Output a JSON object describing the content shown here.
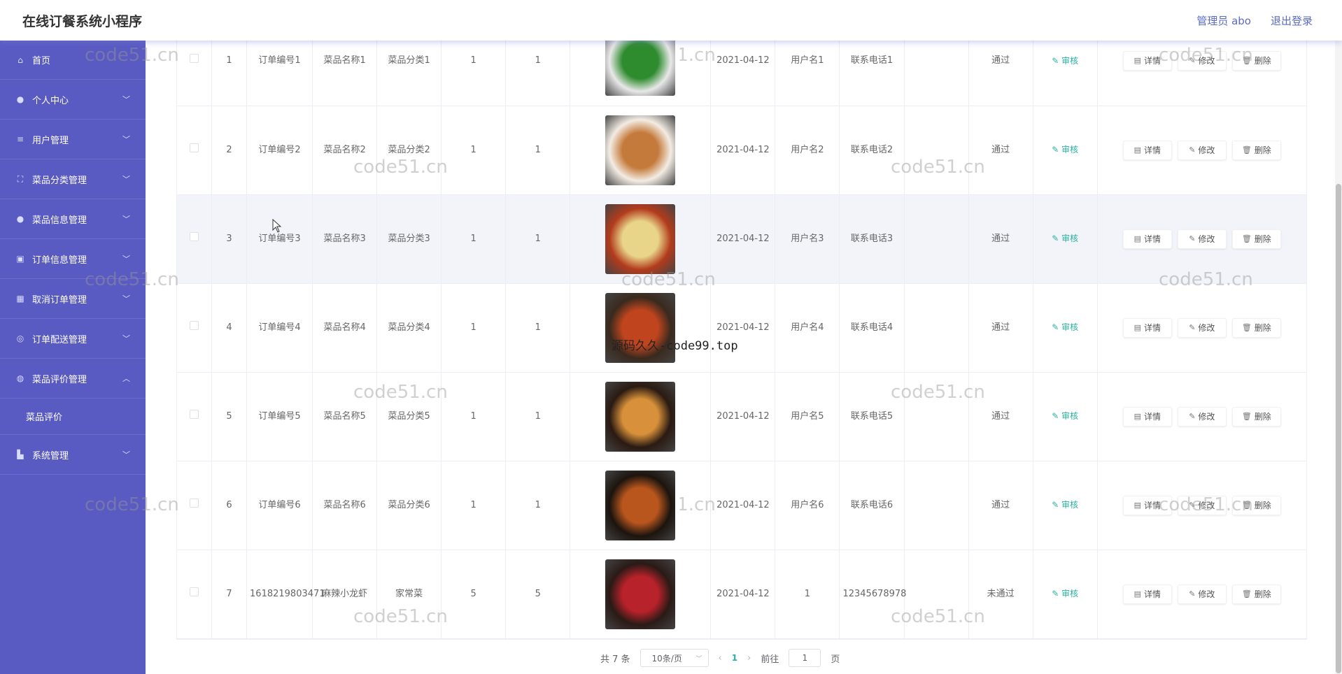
{
  "header": {
    "app_title": "在线订餐系统小程序",
    "admin_label": "管理员 abo",
    "logout": "退出登录"
  },
  "sidebar": {
    "items": [
      {
        "label": "首页",
        "icon": "home-icon",
        "arrow": ""
      },
      {
        "label": "个人中心",
        "icon": "user-icon",
        "arrow": "chevron-down"
      },
      {
        "label": "用户管理",
        "icon": "menu-icon",
        "arrow": "chevron-down"
      },
      {
        "label": "菜品分类管理",
        "icon": "crop-icon",
        "arrow": "chevron-down"
      },
      {
        "label": "菜品信息管理",
        "icon": "pin-icon",
        "arrow": "chevron-down"
      },
      {
        "label": "订单信息管理",
        "icon": "clipboard-icon",
        "arrow": "chevron-down"
      },
      {
        "label": "取消订单管理",
        "icon": "grid-icon",
        "arrow": "chevron-down"
      },
      {
        "label": "订单配送管理",
        "icon": "globe-icon",
        "arrow": "chevron-down"
      },
      {
        "label": "菜品评价管理",
        "icon": "compass-icon",
        "arrow": "chevron-up"
      },
      {
        "label": "系统管理",
        "icon": "settings-icon",
        "arrow": "chevron-down"
      }
    ],
    "submenu": {
      "label": "菜品评价"
    }
  },
  "table": {
    "audit_label": "审核",
    "ops": {
      "detail": "详情",
      "edit": "修改",
      "delete": "删除"
    },
    "rows": [
      {
        "index": "1",
        "order_no": "订单编号1",
        "dish_name": "菜品名称1",
        "dish_category": "菜品分类1",
        "qty": "1",
        "price": "1",
        "date": "2021-04-12",
        "username": "用户名1",
        "phone": "联系电话1",
        "status": "通过",
        "img_color_a": "#2e8b2e",
        "img_color_b": "#e8e8e8"
      },
      {
        "index": "2",
        "order_no": "订单编号2",
        "dish_name": "菜品名称2",
        "dish_category": "菜品分类2",
        "qty": "1",
        "price": "1",
        "date": "2021-04-12",
        "username": "用户名2",
        "phone": "联系电话2",
        "status": "通过",
        "img_color_a": "#c47a3a",
        "img_color_b": "#f3ece4"
      },
      {
        "index": "3",
        "order_no": "订单编号3",
        "dish_name": "菜品名称3",
        "dish_category": "菜品分类3",
        "qty": "1",
        "price": "1",
        "date": "2021-04-12",
        "username": "用户名3",
        "phone": "联系电话3",
        "status": "通过",
        "img_color_a": "#e9d58a",
        "img_color_b": "#b23b1c"
      },
      {
        "index": "4",
        "order_no": "订单编号4",
        "dish_name": "菜品名称4",
        "dish_category": "菜品分类4",
        "qty": "1",
        "price": "1",
        "date": "2021-04-12",
        "username": "用户名4",
        "phone": "联系电话4",
        "status": "通过",
        "img_color_a": "#c0451e",
        "img_color_b": "#3a2a1e"
      },
      {
        "index": "5",
        "order_no": "订单编号5",
        "dish_name": "菜品名称5",
        "dish_category": "菜品分类5",
        "qty": "1",
        "price": "1",
        "date": "2021-04-12",
        "username": "用户名5",
        "phone": "联系电话5",
        "status": "通过",
        "img_color_a": "#d8913a",
        "img_color_b": "#2a1a12"
      },
      {
        "index": "6",
        "order_no": "订单编号6",
        "dish_name": "菜品名称6",
        "dish_category": "菜品分类6",
        "qty": "1",
        "price": "1",
        "date": "2021-04-12",
        "username": "用户名6",
        "phone": "联系电话6",
        "status": "通过",
        "img_color_a": "#b8561e",
        "img_color_b": "#1c140e"
      },
      {
        "index": "7",
        "order_no": "1618219803471",
        "dish_name": "麻辣小龙虾",
        "dish_category": "家常菜",
        "qty": "5",
        "price": "5",
        "date": "2021-04-12",
        "username": "1",
        "phone": "12345678978",
        "status": "未通过",
        "img_color_a": "#b8222a",
        "img_color_b": "#2a1a16"
      }
    ]
  },
  "pagination": {
    "total": "共 7 条",
    "page_size": "10条/页",
    "current_page": "1",
    "goto_label": "前往",
    "goto_value": "1",
    "page_suffix": "页"
  },
  "watermarks": {
    "code51": "code51.cn",
    "code99": "源码久久-code99.top"
  },
  "colors": {
    "sidebar_bg": "#5a5bc2",
    "accent": "#2ab0a0",
    "header_link": "#5a6bc7"
  }
}
